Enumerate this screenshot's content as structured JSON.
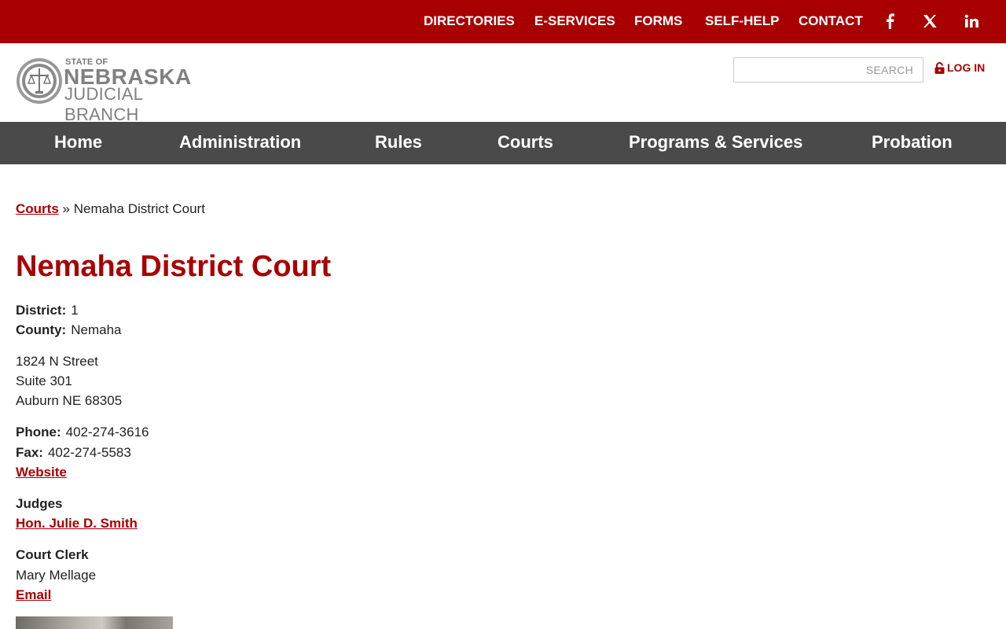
{
  "topbar": {
    "links": [
      "DIRECTORIES",
      "E-SERVICES",
      "FORMS",
      "SELF-HELP",
      "CONTACT"
    ],
    "social": [
      "facebook-icon",
      "x-icon",
      "linkedin-icon"
    ],
    "color": "#a80000"
  },
  "header": {
    "logo": {
      "small": "STATE OF",
      "big": "NEBRASKA",
      "sub": "JUDICIAL BRANCH"
    },
    "search_placeholder": "SEARCH",
    "login_label": "LOG IN"
  },
  "mainnav": {
    "items": [
      "Home",
      "Administration",
      "Rules",
      "Courts",
      "Programs & Services",
      "Probation"
    ],
    "color": "#4a4a4a"
  },
  "breadcrumb": {
    "parent": "Courts",
    "separator": "»",
    "current": "Nemaha District Court"
  },
  "court": {
    "title": "Nemaha District Court",
    "district_label": "District:",
    "district": "1",
    "county_label": "County:",
    "county": "Nemaha",
    "address": [
      "1824 N Street",
      "Suite 301",
      "Auburn NE 68305"
    ],
    "phone_label": "Phone:",
    "phone": "402-274-3616",
    "fax_label": "Fax:",
    "fax": "402-274-5583",
    "website_label": "Website",
    "judges_label": "Judges",
    "judge": "Hon. Julie D. Smith",
    "clerk_label": "Court Clerk",
    "clerk": "Mary Mellage",
    "email_label": "Email"
  }
}
